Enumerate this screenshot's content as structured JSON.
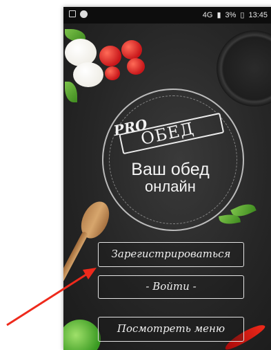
{
  "status_bar": {
    "network": "4G",
    "battery": "3%",
    "time": "13:45"
  },
  "logo": {
    "top_word": "PRO",
    "main_word": "ОБЕД"
  },
  "tagline": {
    "line1": "Ваш обед",
    "line2": "онлайн"
  },
  "buttons": {
    "register": "Зарегистрироваться",
    "login": "- Войти -",
    "view_menu": "Посмотреть меню"
  },
  "colors": {
    "background": "#262626",
    "chalk": "#f0f0f0",
    "arrow": "#ee2a1c"
  },
  "icons": [
    "gallery-icon",
    "android-icon",
    "signal-icon",
    "battery-icon"
  ]
}
